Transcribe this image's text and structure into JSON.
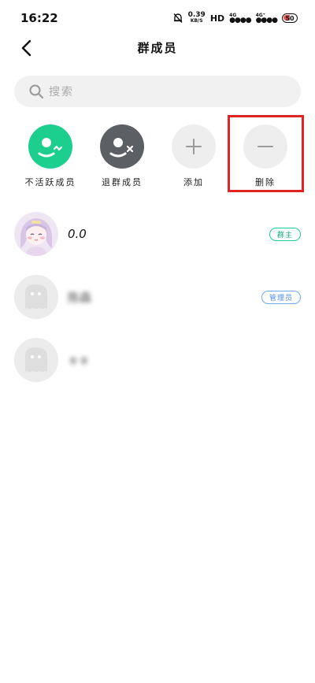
{
  "status_bar": {
    "time": "16:22",
    "speed_value": "0.39",
    "speed_unit": "KB/S",
    "hd": "HD",
    "network_1": "4G",
    "network_2": "4G⁺",
    "battery": "50"
  },
  "header": {
    "title": "群成员"
  },
  "search": {
    "placeholder": "搜索"
  },
  "actions": [
    {
      "label": "不活跃成员",
      "icon": "inactive-member-icon",
      "color": "#1ccf8e"
    },
    {
      "label": "退群成员",
      "icon": "left-member-icon",
      "color": "#5c5f63"
    },
    {
      "label": "添加",
      "icon": "plus-icon",
      "color": "#eeeeee"
    },
    {
      "label": "删除",
      "icon": "minus-icon",
      "color": "#eeeeee"
    }
  ],
  "members": [
    {
      "name": "0.0",
      "role": "群主",
      "avatar": "anime-avatar"
    },
    {
      "name": "陈森",
      "role": "管理员",
      "avatar": "default-avatar"
    },
    {
      "name": "ㅎㅎ",
      "role": "",
      "avatar": "default-avatar"
    }
  ],
  "colors": {
    "accent_green": "#1ccf8e",
    "admin_blue": "#4a8ee8",
    "highlight_red": "#e02424"
  }
}
